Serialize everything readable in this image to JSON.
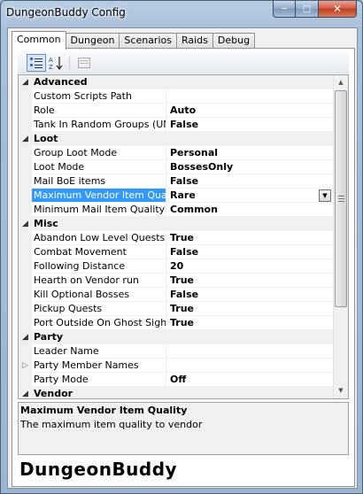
{
  "window": {
    "title": "DungeonBuddy Config",
    "buttons": {
      "minimize": "─",
      "maximize": "□",
      "close": "✕"
    }
  },
  "tabs": [
    {
      "label": "Common",
      "active": true
    },
    {
      "label": "Dungeon",
      "active": false
    },
    {
      "label": "Scenarios",
      "active": false
    },
    {
      "label": "Raids",
      "active": false
    },
    {
      "label": "Debug",
      "active": false
    }
  ],
  "toolbar": {
    "categorized_icon": "categorized-icon",
    "alphabetical_icon": "alphabetical-icon",
    "property_pages_icon": "property-pages-icon"
  },
  "property_grid": {
    "categories": [
      {
        "name": "Advanced",
        "properties": [
          {
            "name": "Custom Scripts Path",
            "value": ""
          },
          {
            "name": "Role",
            "value": "Auto"
          },
          {
            "name": "Tank In Random Groups (UNS/",
            "value": "False"
          }
        ]
      },
      {
        "name": "Loot",
        "properties": [
          {
            "name": "Group Loot Mode",
            "value": "Personal"
          },
          {
            "name": "Loot Mode",
            "value": "BossesOnly"
          },
          {
            "name": "Mail BoE items",
            "value": "False"
          },
          {
            "name": "Maximum Vendor Item Quality",
            "value": "Rare",
            "selected": true
          },
          {
            "name": "Minimum Mail Item Quality",
            "value": "Common"
          }
        ]
      },
      {
        "name": "Misc",
        "properties": [
          {
            "name": "Abandon Low Level Quests",
            "value": "True"
          },
          {
            "name": "Combat Movement",
            "value": "False"
          },
          {
            "name": "Following Distance",
            "value": "20"
          },
          {
            "name": "Hearth on Vendor run",
            "value": "True"
          },
          {
            "name": "Kill Optional Bosses",
            "value": "False"
          },
          {
            "name": "Pickup Quests",
            "value": "True"
          },
          {
            "name": "Port Outside On Ghost Sighting",
            "value": "True"
          }
        ]
      },
      {
        "name": "Party",
        "properties": [
          {
            "name": "Leader Name",
            "value": ""
          },
          {
            "name": "Party Member Names",
            "value": "",
            "expandable": true
          },
          {
            "name": "Party Mode",
            "value": "Off"
          }
        ]
      },
      {
        "name": "Vendor",
        "properties": []
      }
    ]
  },
  "help": {
    "title": "Maximum Vendor Item Quality",
    "description": "The maximum item quality to vendor"
  },
  "brand": "DungeonBuddy"
}
